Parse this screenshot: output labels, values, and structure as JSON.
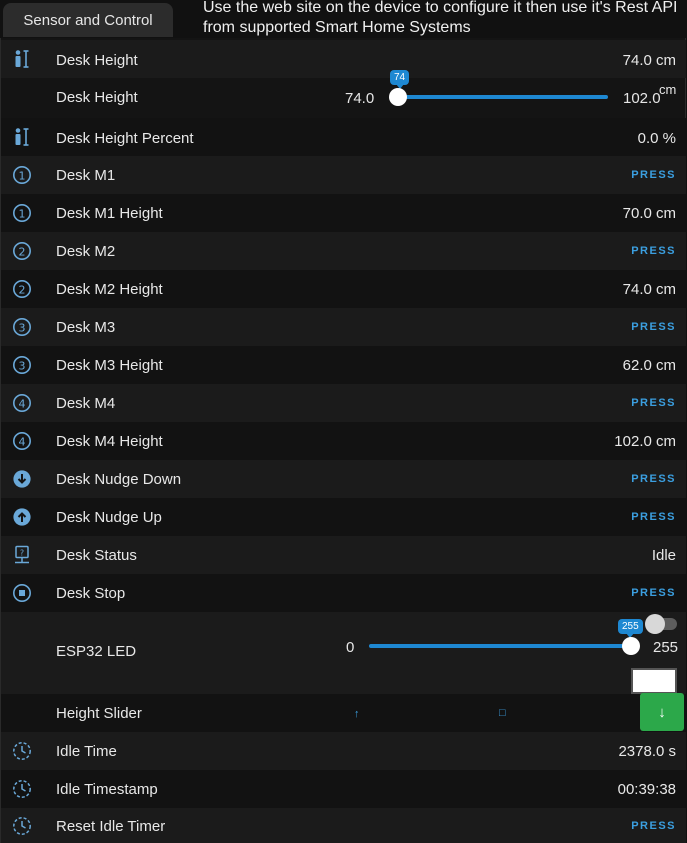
{
  "tab": {
    "label": "Sensor and Control"
  },
  "note": "Use the web site on the device to configure it then use it's Rest API from  supported Smart Home Systems",
  "accent": "#1e88d2",
  "press_label": "PRESS",
  "rows": {
    "desk_height": {
      "label": "Desk Height",
      "value": "74.0 cm",
      "icon": "person-height-icon"
    },
    "desk_height_slider": {
      "label": "Desk Height",
      "min": "74.0",
      "max": "102.0",
      "unit": "cm",
      "bubble": "74",
      "level": 0.0
    },
    "desk_height_percent": {
      "label": "Desk Height Percent",
      "value": "0.0 %",
      "icon": "person-height-icon"
    },
    "desk_m1": {
      "label": "Desk M1",
      "icon": "circle-1-icon"
    },
    "desk_m1_height": {
      "label": "Desk M1 Height",
      "value": "70.0 cm",
      "icon": "circle-1-icon"
    },
    "desk_m2": {
      "label": "Desk M2",
      "icon": "circle-2-icon"
    },
    "desk_m2_height": {
      "label": "Desk M2 Height",
      "value": "74.0 cm",
      "icon": "circle-2-icon"
    },
    "desk_m3": {
      "label": "Desk M3",
      "icon": "circle-3-icon"
    },
    "desk_m3_height": {
      "label": "Desk M3 Height",
      "value": "62.0 cm",
      "icon": "circle-3-icon"
    },
    "desk_m4": {
      "label": "Desk M4",
      "icon": "circle-4-icon"
    },
    "desk_m4_height": {
      "label": "Desk M4 Height",
      "value": "102.0 cm",
      "icon": "circle-4-icon"
    },
    "desk_nudge_down": {
      "label": "Desk Nudge Down",
      "icon": "arrow-down-circle-icon"
    },
    "desk_nudge_up": {
      "label": "Desk Nudge Up",
      "icon": "arrow-up-circle-icon"
    },
    "desk_status": {
      "label": "Desk Status",
      "value": "Idle",
      "icon": "help-network-icon"
    },
    "desk_stop": {
      "label": "Desk Stop",
      "icon": "stop-circle-icon"
    },
    "esp32_led": {
      "label": "ESP32 LED",
      "min": "0",
      "max": "255",
      "bubble": "255",
      "level": 1.0
    },
    "height_slider": {
      "label": "Height Slider",
      "up": "↑",
      "stop": "□",
      "down": "↓"
    },
    "idle_time": {
      "label": "Idle Time",
      "value": "2378.0 s",
      "icon": "clock-outline-icon"
    },
    "idle_timestamp": {
      "label": "Idle Timestamp",
      "value": "00:39:38",
      "icon": "clock-outline-icon"
    },
    "reset_idle_timer": {
      "label": "Reset Idle Timer",
      "icon": "clock-outline-icon"
    }
  }
}
